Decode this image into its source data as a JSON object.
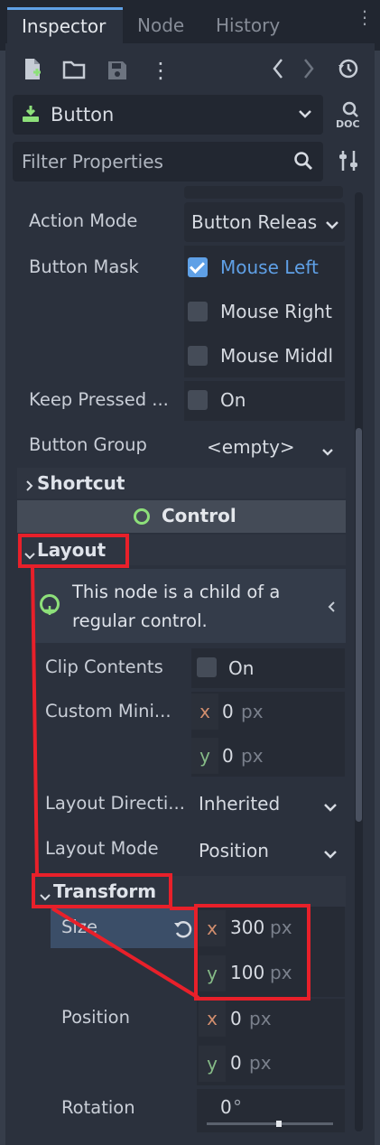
{
  "tabs": [
    "Inspector",
    "Node",
    "History"
  ],
  "node": {
    "type_name": "Button"
  },
  "toolbar": {
    "icons": [
      "new-script-icon",
      "open-icon",
      "save-icon",
      "more-icon",
      "back-icon",
      "forward-icon",
      "history-icon"
    ],
    "doc_label": "DOC"
  },
  "filter": {
    "placeholder": "Filter Properties"
  },
  "props": {
    "action_mode": {
      "label": "Action Mode",
      "value": "Button Releas"
    },
    "button_mask": {
      "label": "Button Mask",
      "options": [
        {
          "label": "Mouse Left",
          "checked": true
        },
        {
          "label": "Mouse Right",
          "checked": false
        },
        {
          "label": "Mouse Middl",
          "checked": false
        }
      ]
    },
    "keep_pressed": {
      "label": "Keep Pressed ...",
      "value": "On"
    },
    "button_group": {
      "label": "Button Group",
      "value": "<empty>"
    }
  },
  "sections": {
    "shortcut": "Shortcut",
    "control": "Control",
    "layout": "Layout",
    "transform": "Transform"
  },
  "layout": {
    "info": "This node is a child of a regular control.",
    "clip_contents": {
      "label": "Clip Contents",
      "value": "On"
    },
    "custom_min": {
      "label": "Custom Mini...",
      "x": "0",
      "y": "0",
      "unit": "px"
    },
    "layout_direction": {
      "label": "Layout Directi...",
      "value": "Inherited"
    },
    "layout_mode": {
      "label": "Layout Mode",
      "value": "Position"
    }
  },
  "transform": {
    "size": {
      "label": "Size",
      "x": "300",
      "y": "100",
      "unit": "px"
    },
    "position": {
      "label": "Position",
      "x": "0",
      "y": "0",
      "unit": "px"
    },
    "rotation": {
      "label": "Rotation",
      "value": "0",
      "unit": "°",
      "fraction": 0.57
    }
  },
  "colors": {
    "accent": "#5fa0e6",
    "highlight": "#e8202a",
    "control_icon": "#8de07a"
  }
}
